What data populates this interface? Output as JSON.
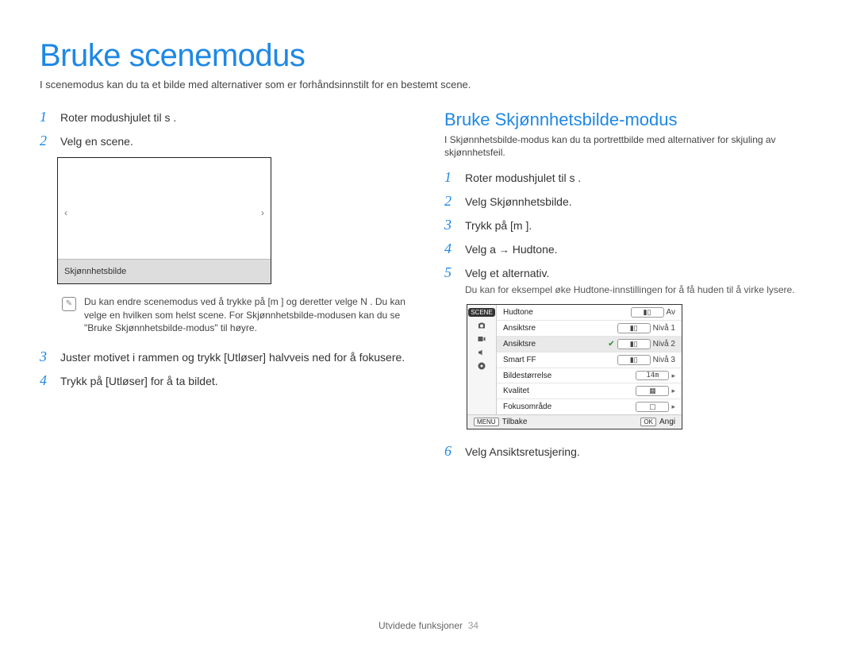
{
  "page_title": "Bruke scenemodus",
  "intro": "I scenemodus kan du ta et bilde med alternativer som er forhåndsinnstilt for en bestemt scene.",
  "left_steps": [
    {
      "num": "1",
      "text": "Roter modushjulet til s        ."
    },
    {
      "num": "2",
      "text": "Velg en scene."
    },
    {
      "num": "3",
      "text": "Juster motivet i rammen og trykk [Utløser] halvveis ned for å fokusere."
    },
    {
      "num": "4",
      "text": "Trykk på [Utløser] for å ta bildet."
    }
  ],
  "preview_label": "Skjønnhetsbilde",
  "note_text": "Du kan endre scenemodus ved å trykke på [m       ] og deretter velge N      . Du kan velge en hvilken som helst scene. For Skjønnhetsbilde-modusen kan du se \"Bruke Skjønnhetsbilde-modus\" til høyre.",
  "sub_heading": "Bruke Skjønnhetsbilde-modus",
  "sub_intro": "I Skjønnhetsbilde-modus kan du ta portrettbilde med alternativer for skjuling av skjønnhetsfeil.",
  "right_steps": [
    {
      "num": "1",
      "text": "Roter modushjulet til s        ."
    },
    {
      "num": "2",
      "text": "Velg Skjønnhetsbilde."
    },
    {
      "num": "3",
      "text": "Trykk på [m      ]."
    },
    {
      "num": "4",
      "text_prefix": "Velg a     ",
      "text_suffix": " Hudtone."
    },
    {
      "num": "5",
      "text": "Velg et alternativ.",
      "desc": "Du kan for eksempel øke Hudtone-innstillingen for å få huden til å virke lysere."
    },
    {
      "num": "6",
      "text": "Velg Ansiktsretusjering."
    }
  ],
  "camera_screen": {
    "rows": [
      {
        "label": "Hudtone",
        "value": "Av",
        "icon": "level"
      },
      {
        "label": "Ansiktsre",
        "value": "Nivå 1",
        "icon": "level"
      },
      {
        "label": "Ansiktsre",
        "value": "Nivå 2",
        "icon": "level",
        "hl": true
      },
      {
        "label": "Smart FF",
        "value": "Nivå 3",
        "icon": "level"
      },
      {
        "label": "Bildestørrelse",
        "value": "14m",
        "icon": ""
      },
      {
        "label": "Kvalitet",
        "value": "",
        "icon": "square"
      },
      {
        "label": "Fokusområde",
        "value": "",
        "icon": "square"
      }
    ],
    "left_scene": "SCENE",
    "back": {
      "key": "MENU",
      "label": "Tilbake"
    },
    "set": {
      "key": "OK",
      "label": "Angi"
    }
  },
  "footer": {
    "section": "Utvidede funksjoner",
    "page": "34"
  }
}
